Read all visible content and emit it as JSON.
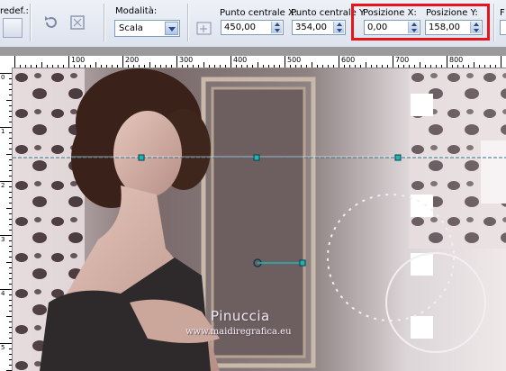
{
  "toolbar": {
    "preset_label": "redef.:",
    "mode": {
      "label": "Modalità:",
      "value": "Scala"
    },
    "center_x": {
      "label": "Punto centrale X:",
      "value": "450,00"
    },
    "center_y": {
      "label": "Punto centrale Y",
      "value": "354,00"
    },
    "pos_x": {
      "label": "Posizione X:",
      "value": "0,00"
    },
    "pos_y": {
      "label": "Posizione Y:",
      "value": "158,00"
    },
    "truncated_label": "F",
    "highlight_color": "#e8141c"
  },
  "ruler": {
    "h_ticks": [
      "100",
      "200",
      "300",
      "400",
      "500",
      "600",
      "700",
      "800"
    ],
    "v_ticks": [
      "0",
      "1",
      "2",
      "3",
      "4",
      "5"
    ]
  },
  "image": {
    "watermark_name": "Pinuccia",
    "watermark_url": "www.maidiregrafica.eu"
  }
}
